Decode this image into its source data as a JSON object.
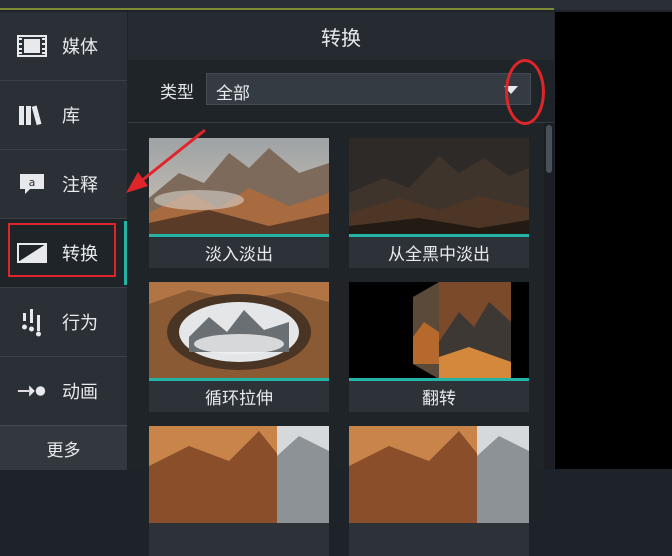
{
  "sidebar": {
    "items": [
      {
        "label": "媒体",
        "icon": "film-icon"
      },
      {
        "label": "库",
        "icon": "library-icon"
      },
      {
        "label": "注释",
        "icon": "annotation-icon"
      },
      {
        "label": "转换",
        "icon": "transition-icon"
      },
      {
        "label": "行为",
        "icon": "behavior-icon"
      },
      {
        "label": "动画",
        "icon": "animation-icon"
      }
    ],
    "more_label": "更多"
  },
  "panel": {
    "title": "转换",
    "type_label": "类型",
    "type_value": "全部",
    "thumbnails": [
      {
        "caption": "淡入淡出"
      },
      {
        "caption": "从全黑中淡出"
      },
      {
        "caption": "循环拉伸"
      },
      {
        "caption": "翻转"
      },
      {
        "caption": ""
      },
      {
        "caption": ""
      }
    ]
  },
  "colors": {
    "accent": "#22b5a6",
    "annotation": "#e0252a",
    "background": "#1e2329"
  }
}
